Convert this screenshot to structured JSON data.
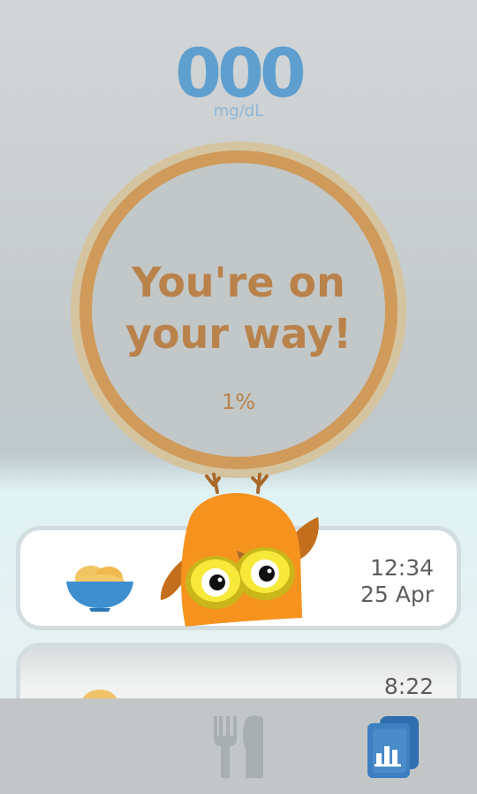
{
  "reading": {
    "value": "000",
    "unit": "mg/dL"
  },
  "progress": {
    "message_line1": "You're on",
    "message_line2": "your way!",
    "percent_label": "1%",
    "percent_value": 1
  },
  "entries": [
    {
      "time": "12:34",
      "date": "25 Apr",
      "icon": "food-bowl-icon"
    },
    {
      "time": "8:22",
      "date": "",
      "icon": "food-bowl-icon"
    }
  ],
  "nav": {
    "meals_icon": "fork-knife-icon",
    "log_icon": "report-book-icon"
  },
  "colors": {
    "accent_blue": "#5f9fcf",
    "ring": "#cf9a5a",
    "text_brown": "#b9824b",
    "owl_orange": "#f6921e"
  }
}
